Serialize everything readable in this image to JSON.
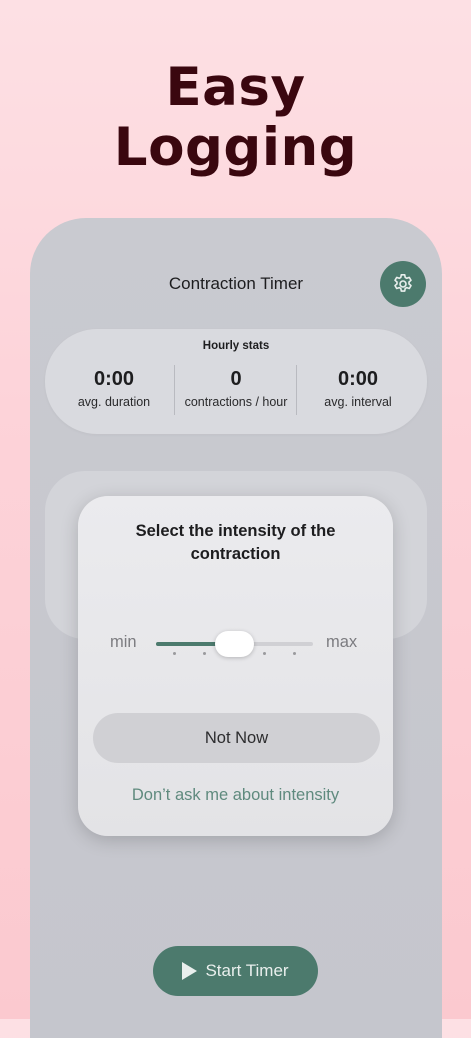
{
  "headline": {
    "line1": "Easy",
    "line2": "Logging"
  },
  "app": {
    "title": "Contraction Timer",
    "settings_icon": "gear-icon"
  },
  "stats": {
    "heading": "Hourly stats",
    "items": [
      {
        "value": "0:00",
        "label": "avg. duration"
      },
      {
        "value": "0",
        "label": "contractions / hour"
      },
      {
        "value": "0:00",
        "label": "avg. interval"
      }
    ]
  },
  "intensity_modal": {
    "title": "Select the intensity of the contraction",
    "min_label": "min",
    "max_label": "max",
    "slider_level": 0.5,
    "not_now_label": "Not Now",
    "dont_ask_label": "Don’t ask me about intensity"
  },
  "start_button": {
    "label": "Start Timer",
    "icon": "play-icon"
  },
  "colors": {
    "accent": "#4c7a6d",
    "headline": "#3a070f",
    "background": "#fdd3d9"
  }
}
